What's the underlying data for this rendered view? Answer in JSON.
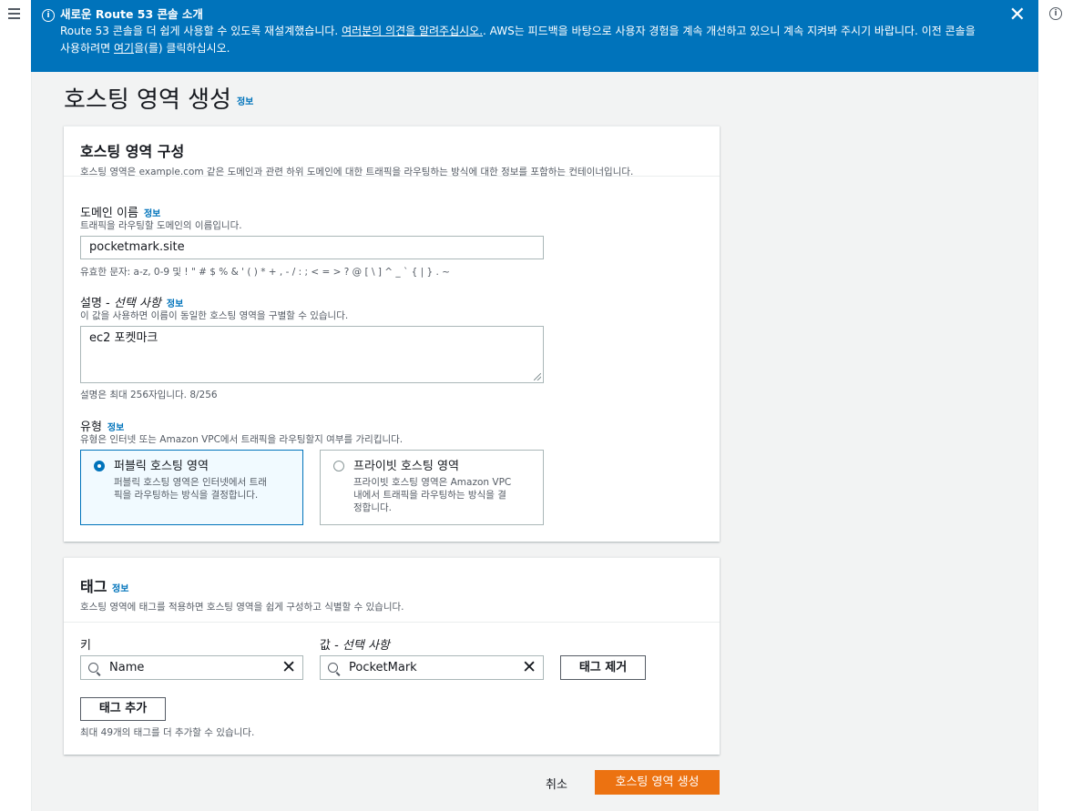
{
  "flash": {
    "title": "새로운 Route 53 콘솔 소개",
    "body_1": "Route 53 콘솔을 더 쉽게 사용할 수 있도록 재설계했습니다. ",
    "feedback_link": "여러분의 의견을 알려주십시오.",
    "body_2": ". AWS는 피드백을 바탕으로 사용자 경험을 계속 개선하고 있으니 계속 지켜봐 주시기 바랍니다. 이전 콘솔을 사용하려면 ",
    "here_link": "여기",
    "body_3": "을(를) 클릭하십시오."
  },
  "page": {
    "title": "호스팅 영역 생성",
    "info": "정보"
  },
  "config": {
    "title": "호스팅 영역 구성",
    "description": "호스팅 영역은 example.com 같은 도메인과 관련 하위 도메인에 대한 트래픽을 라우팅하는 방식에 대한 정보를 포함하는 컨테이너입니다.",
    "domain": {
      "label": "도메인 이름",
      "info": "정보",
      "description": "트래픽을 라우팅할 도메인의 이름입니다.",
      "value": "pocketmark.site",
      "hint": "유효한 문자: a-z, 0-9 및 ! \" # $ % & ' ( ) * + , - / : ; < = > ? @ [ \\ ] ^ _ ` { | } . ~"
    },
    "comment": {
      "label_main": "설명 - ",
      "label_optional": "선택 사항",
      "info": "정보",
      "description": "이 값을 사용하면 이름이 동일한 호스팅 영역을 구별할 수 있습니다.",
      "value": "ec2 포켓마크",
      "hint": "설명은 최대 256자입니다. 8/256"
    },
    "type": {
      "label": "유형",
      "info": "정보",
      "description": "유형은 인터넷 또는 Amazon VPC에서 트래픽을 라우팅할지 여부를 가리킵니다.",
      "options": [
        {
          "title": "퍼블릭 호스팅 영역",
          "desc_1": "퍼블릭 호스팅 영역은 인터넷에서 트래",
          "desc_2": "픽을 라우팅하는 방식을 결정합니다.",
          "desc_3": "",
          "selected": true
        },
        {
          "title": "프라이빗 호스팅 영역",
          "desc_1": "프라이빗 호스팅 영역은 Amazon VPC",
          "desc_2": "내에서 트래픽을 라우팅하는 방식을 결",
          "desc_3": "정합니다.",
          "selected": false
        }
      ]
    }
  },
  "tags": {
    "title": "태그",
    "info": "정보",
    "description": "호스팅 영역에 태그를 적용하면 호스팅 영역을 쉽게 구성하고 식별할 수 있습니다.",
    "key_label": "키",
    "value_label_main": "값 - ",
    "value_label_optional": "선택 사항",
    "key_value": "Name",
    "value_value": "PocketMark",
    "remove_label": "태그 제거",
    "add_label": "태그 추가",
    "limit_text": "최대 49개의 태그를 더 추가할 수 있습니다."
  },
  "footer": {
    "cancel_label": "취소",
    "create_label": "호스팅 영역 생성"
  },
  "colors": {
    "flash_bg": "#0073bb",
    "primary": "#ec7211",
    "link": "#0073bb"
  }
}
